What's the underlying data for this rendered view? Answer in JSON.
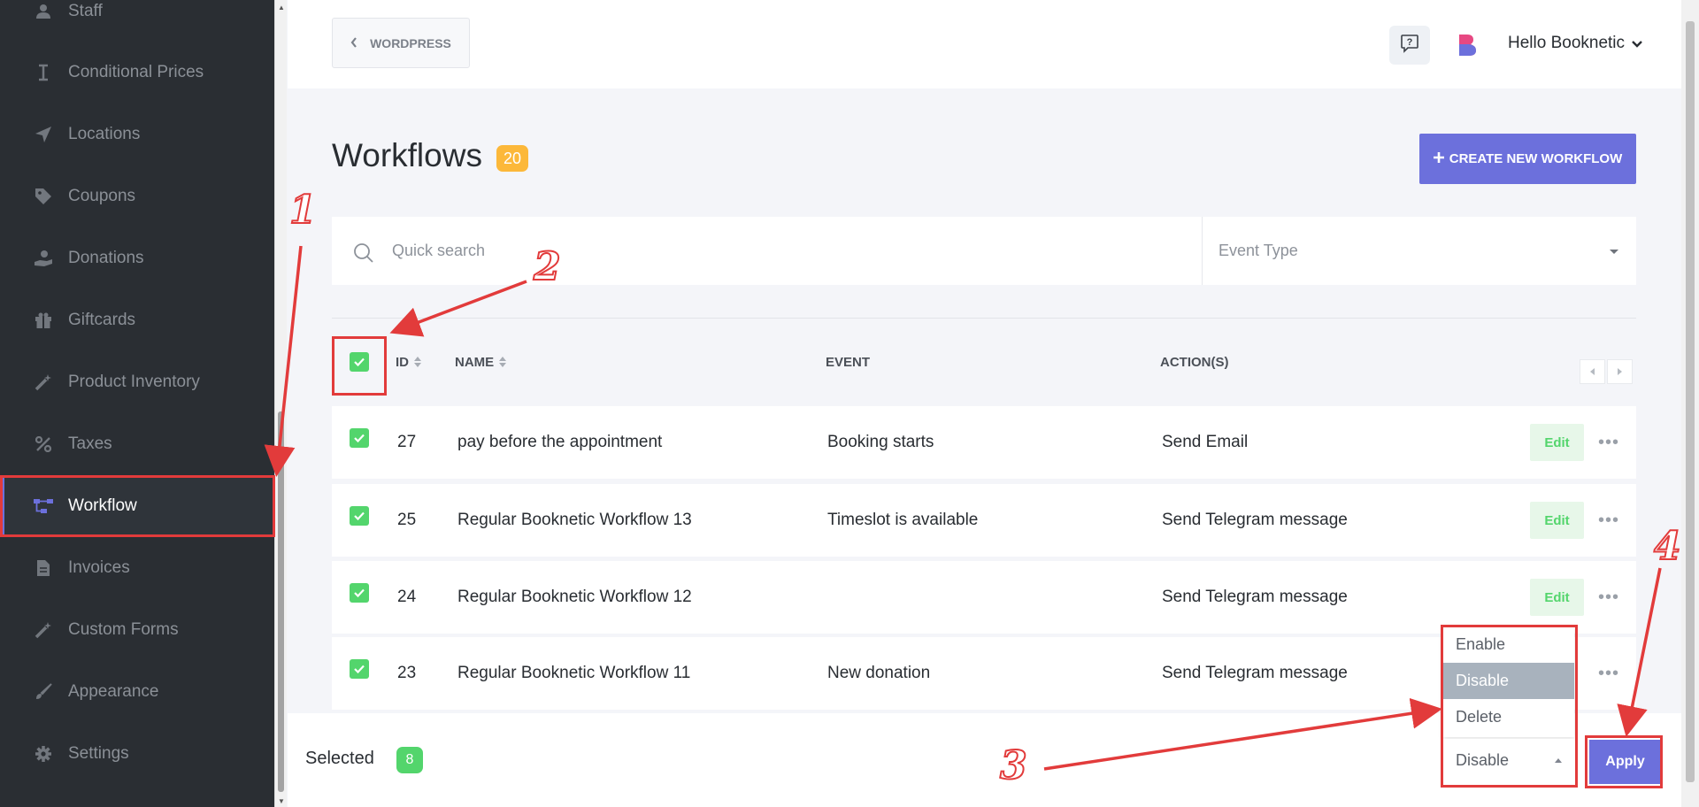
{
  "sidebar": {
    "items": [
      {
        "label": "Staff",
        "icon": "user-icon"
      },
      {
        "label": "Conditional Prices",
        "icon": "text-cursor-icon"
      },
      {
        "label": "Locations",
        "icon": "location-arrow-icon"
      },
      {
        "label": "Coupons",
        "icon": "tag-icon"
      },
      {
        "label": "Donations",
        "icon": "hand-holding-icon"
      },
      {
        "label": "Giftcards",
        "icon": "gift-icon"
      },
      {
        "label": "Product Inventory",
        "icon": "magic-wand-icon"
      },
      {
        "label": "Taxes",
        "icon": "percent-icon"
      },
      {
        "label": "Workflow",
        "icon": "workflow-icon",
        "active": true
      },
      {
        "label": "Invoices",
        "icon": "file-icon"
      },
      {
        "label": "Custom Forms",
        "icon": "magic-wand-icon"
      },
      {
        "label": "Appearance",
        "icon": "brush-icon"
      },
      {
        "label": "Settings",
        "icon": "gear-icon"
      }
    ]
  },
  "header": {
    "back_label": "WORDPRESS",
    "user_greeting": "Hello Booknetic"
  },
  "page": {
    "title": "Workflows",
    "count": "20",
    "create_label": "CREATE NEW WORKFLOW"
  },
  "filters": {
    "search_placeholder": "Quick search",
    "event_type_placeholder": "Event Type"
  },
  "table": {
    "columns": {
      "id": "ID",
      "name": "NAME",
      "event": "EVENT",
      "actions": "ACTION(S)"
    },
    "edit_label": "Edit",
    "rows": [
      {
        "id": "27",
        "name": "pay before the appointment",
        "event": "Booking starts",
        "action": "Send Email",
        "checked": true
      },
      {
        "id": "25",
        "name": "Regular Booknetic Workflow 13",
        "event": "Timeslot is available",
        "action": "Send Telegram message",
        "checked": true
      },
      {
        "id": "24",
        "name": "Regular Booknetic Workflow 12",
        "event": "",
        "action": "Send Telegram message",
        "checked": true
      },
      {
        "id": "23",
        "name": "Regular Booknetic Workflow 11",
        "event": "New donation",
        "action": "Send Telegram message",
        "checked": true
      }
    ]
  },
  "bulk": {
    "selected_label": "Selected",
    "selected_count": "8",
    "options": [
      "Enable",
      "Disable",
      "Delete"
    ],
    "highlighted_option": "Disable",
    "current_value": "Disable",
    "apply_label": "Apply"
  },
  "annotations": {
    "labels": [
      "1",
      "2",
      "3",
      "4"
    ],
    "color": "#e23b3b"
  },
  "colors": {
    "accent": "#6c70dc",
    "success": "#53d56c",
    "badge": "#fcb83a",
    "sidebar_bg": "#2a2e33"
  }
}
